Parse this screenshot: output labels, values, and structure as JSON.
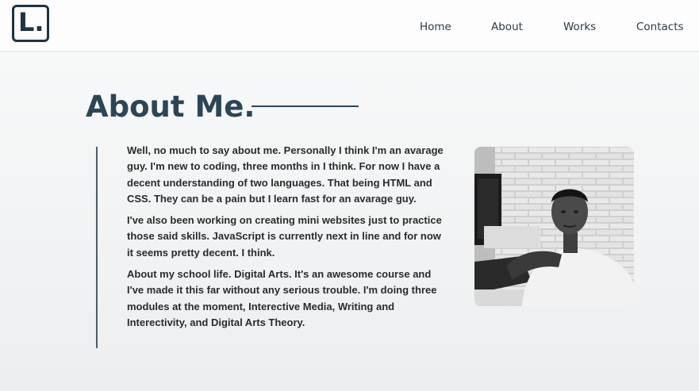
{
  "logo": {
    "text": "L."
  },
  "nav": {
    "items": [
      {
        "label": "Home"
      },
      {
        "label": "About"
      },
      {
        "label": "Works"
      },
      {
        "label": "Contacts"
      }
    ]
  },
  "about": {
    "heading": "About Me.",
    "paragraphs": [
      "Well, no much to say about me. Personally I think I'm an avarage guy. I'm new to coding, three months in I think. For now I have a decent understanding of two languages. That being HTML and CSS. They can be a pain but I learn fast for an avarage guy.",
      "I've also been working on creating mini websites just to practice those said skills. JavaScript is currently next in line and for now it seems pretty decent. I think.",
      "About my school life. Digital Arts. It's an awesome course and I've made it this far without any serious trouble. I'm doing three modules at the moment, Interective Media, Writing and Interectivity, and Digital Arts Theory."
    ]
  },
  "colors": {
    "heading": "#2a4657",
    "logo": "#1f3441",
    "text": "#2b2b2b"
  }
}
